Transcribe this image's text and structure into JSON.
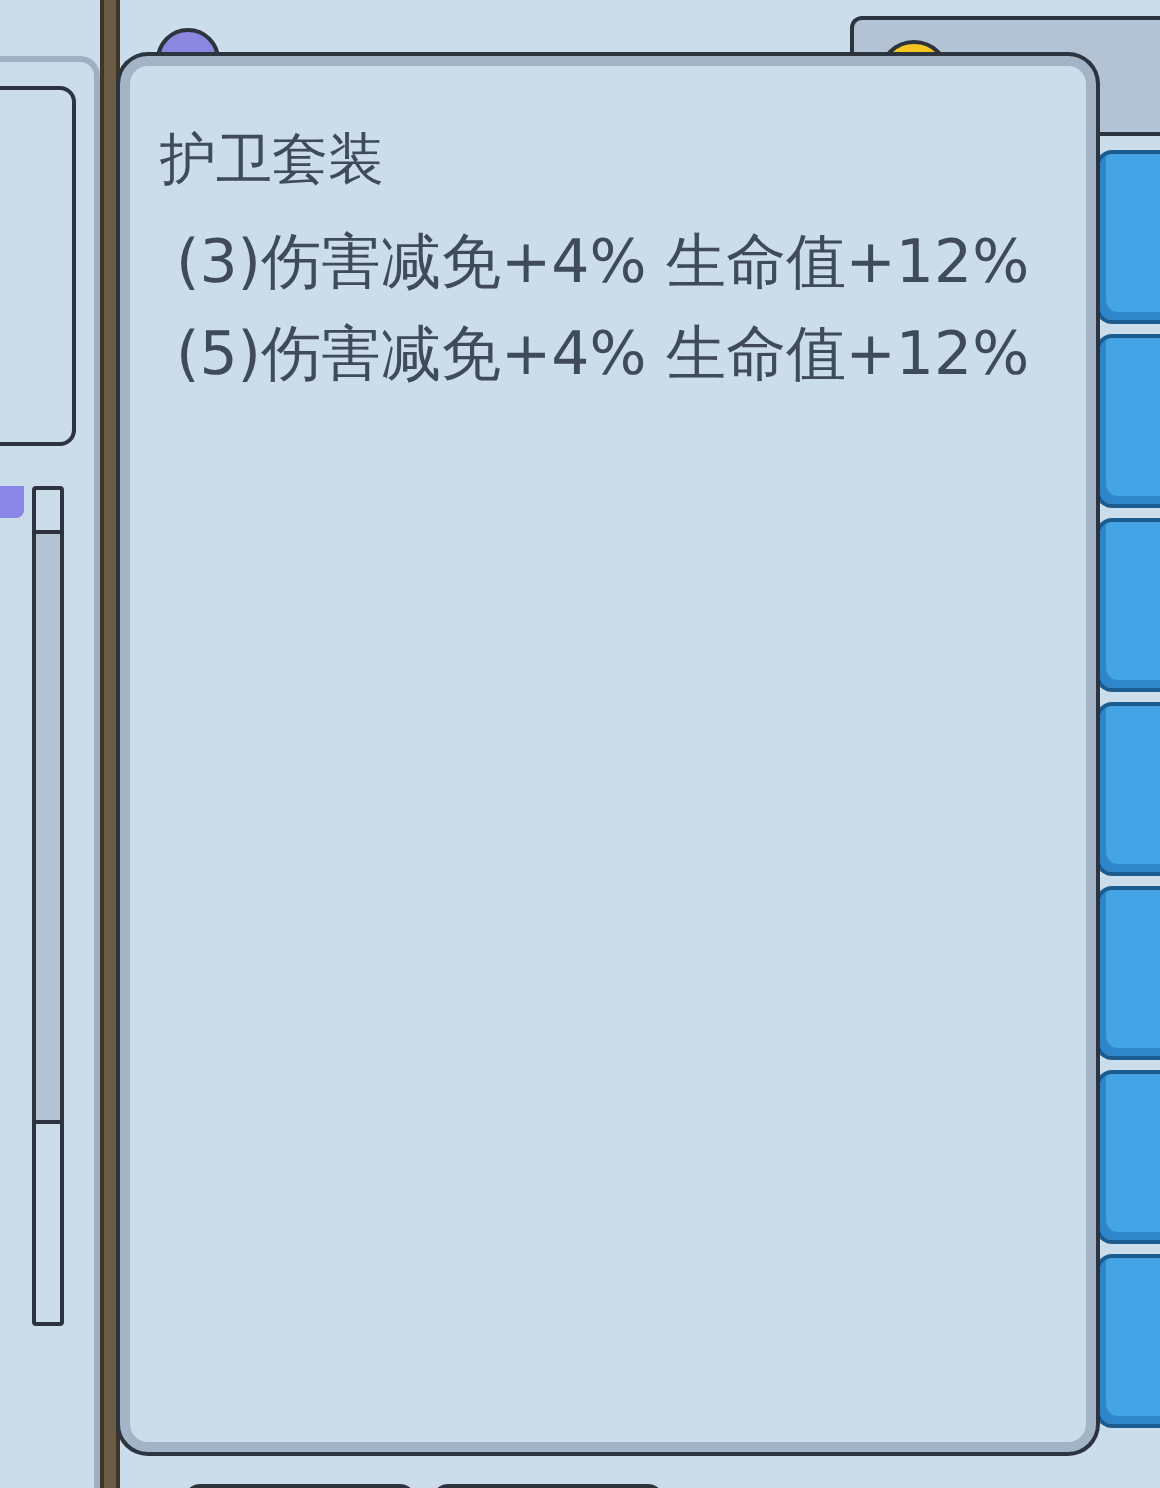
{
  "popup": {
    "title": "护卫套装",
    "lines": [
      "(3)伤害减免+4% 生命值+12%",
      "(5)伤害减免+4% 生命值+12%"
    ]
  }
}
